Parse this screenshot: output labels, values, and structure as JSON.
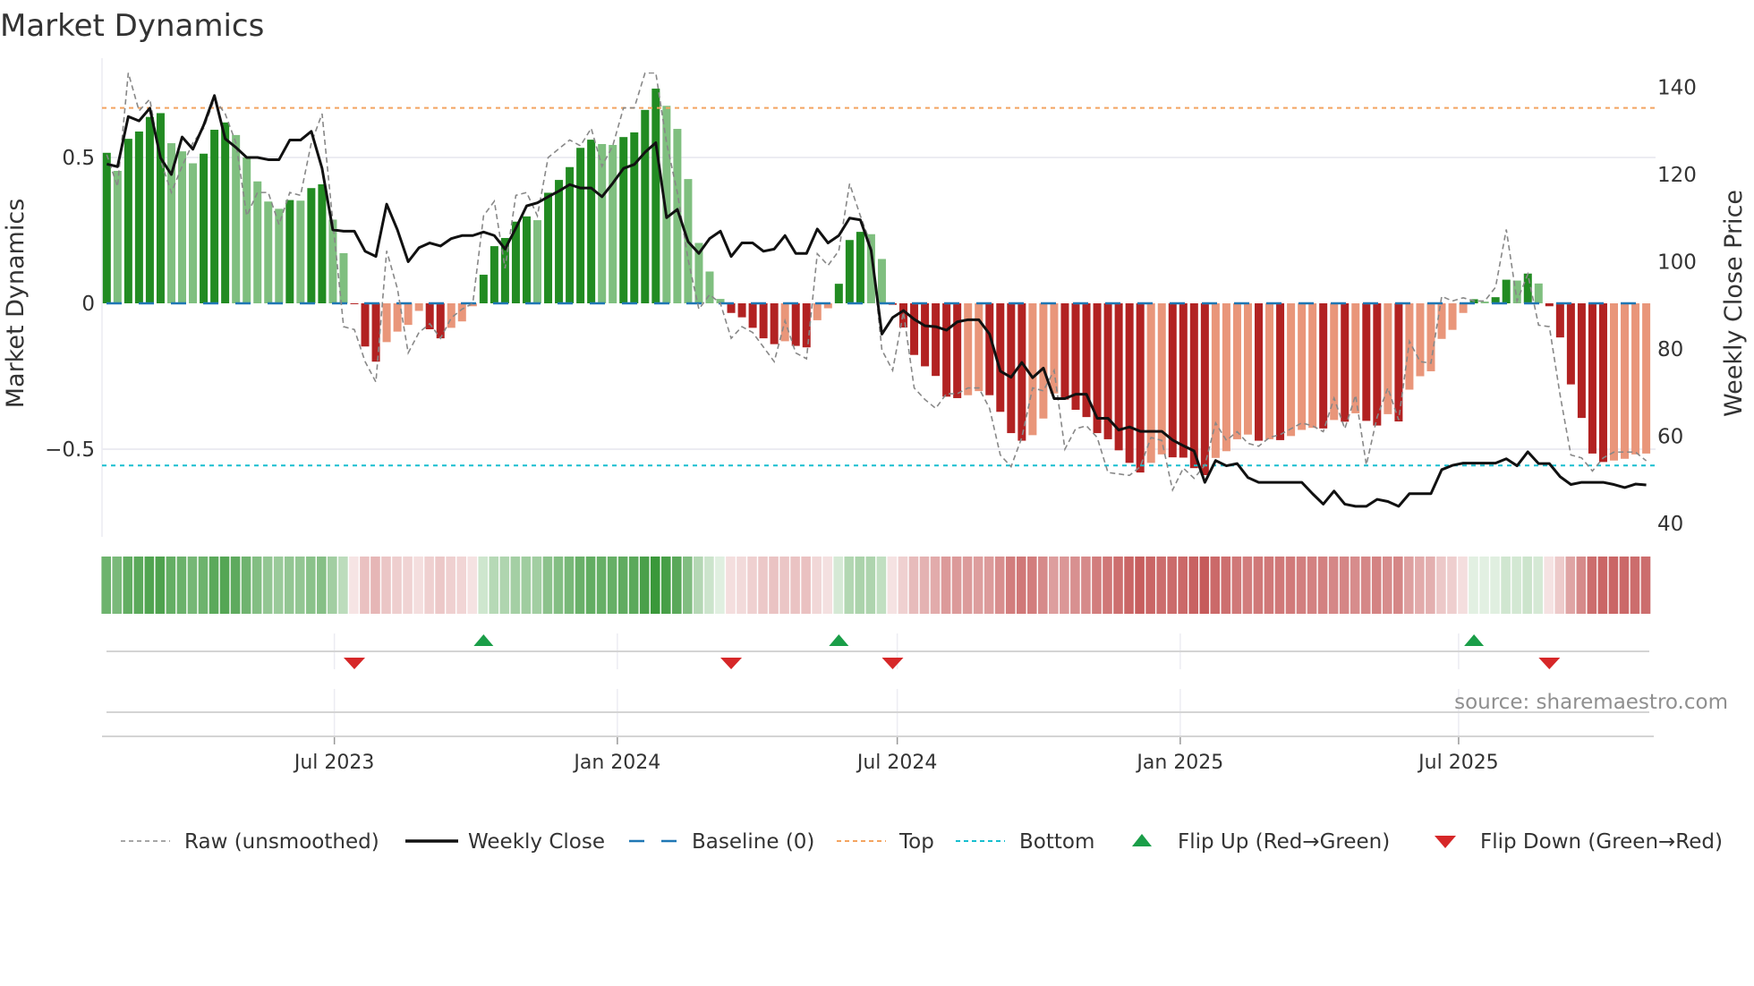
{
  "chart_data": {
    "type": "bar",
    "title": "Market Dynamics",
    "ylabel": "Market Dynamics",
    "y2label": "Weekly Close Price",
    "ylim": [
      -0.8,
      0.79
    ],
    "y2lim": [
      36.9,
      143.4
    ],
    "yticks": [
      {
        "v": 0.5,
        "label": "0.5"
      },
      {
        "v": 0,
        "label": "0"
      },
      {
        "v": -0.5,
        "label": "−0.5"
      }
    ],
    "y2ticks": [
      {
        "v": 140,
        "label": "140"
      },
      {
        "v": 120,
        "label": "120"
      },
      {
        "v": 100,
        "label": "100"
      },
      {
        "v": 80,
        "label": "80"
      },
      {
        "v": 60,
        "label": "60"
      },
      {
        "v": 40,
        "label": "40"
      }
    ],
    "x_start_date": "2023-02-03",
    "x_interval_days": 7,
    "xticks": [
      {
        "date": "2023-07-01",
        "label": "Jul 2023"
      },
      {
        "date": "2024-01-01",
        "label": "Jan 2024"
      },
      {
        "date": "2024-07-01",
        "label": "Jul 2024"
      },
      {
        "date": "2025-01-01",
        "label": "Jan 2025"
      },
      {
        "date": "2025-07-01",
        "label": "Jul 2025"
      }
    ],
    "top_level": 0.67,
    "bottom_level": -0.556,
    "baseline": 0,
    "grid": true,
    "legend_position": "bottom",
    "colors": {
      "pos_strong": "#228b22",
      "pos_weak": "#7fbf7f",
      "neg_strong": "#b22222",
      "neg_weak": "#e9967a",
      "baseline": "#1f77b4",
      "top": "#f4a460",
      "bottom": "#17becf",
      "close": "#111111",
      "raw": "#888888",
      "flip_up": "#1a9e48",
      "flip_down": "#d62728",
      "heat_pos": "34,139,34",
      "heat_neg": "178,34,34"
    },
    "momentum": [
      0.516,
      0.454,
      0.564,
      0.589,
      0.639,
      0.652,
      0.549,
      0.521,
      0.48,
      0.513,
      0.595,
      0.62,
      0.577,
      0.5,
      0.418,
      0.349,
      0.324,
      0.354,
      0.352,
      0.395,
      0.408,
      0.287,
      0.172,
      -0.003,
      -0.148,
      -0.2,
      -0.133,
      -0.097,
      -0.074,
      -0.026,
      -0.089,
      -0.12,
      -0.084,
      -0.062,
      -0.01,
      0.098,
      0.196,
      0.224,
      0.28,
      0.298,
      0.285,
      0.379,
      0.423,
      0.467,
      0.533,
      0.561,
      0.546,
      0.543,
      0.57,
      0.586,
      0.663,
      0.736,
      0.677,
      0.598,
      0.426,
      0.207,
      0.109,
      0.015,
      -0.033,
      -0.048,
      -0.084,
      -0.12,
      -0.14,
      -0.13,
      -0.146,
      -0.151,
      -0.058,
      -0.017,
      0.067,
      0.217,
      0.245,
      0.237,
      0.152,
      -0.005,
      -0.083,
      -0.177,
      -0.216,
      -0.249,
      -0.32,
      -0.325,
      -0.315,
      -0.301,
      -0.315,
      -0.372,
      -0.445,
      -0.471,
      -0.452,
      -0.395,
      -0.309,
      -0.33,
      -0.365,
      -0.39,
      -0.445,
      -0.466,
      -0.504,
      -0.547,
      -0.58,
      -0.547,
      -0.518,
      -0.528,
      -0.529,
      -0.565,
      -0.589,
      -0.53,
      -0.507,
      -0.466,
      -0.45,
      -0.471,
      -0.466,
      -0.469,
      -0.455,
      -0.434,
      -0.427,
      -0.429,
      -0.4,
      -0.406,
      -0.377,
      -0.403,
      -0.419,
      -0.38,
      -0.405,
      -0.296,
      -0.25,
      -0.233,
      -0.122,
      -0.091,
      -0.033,
      0.014,
      0.006,
      0.021,
      0.081,
      0.078,
      0.102,
      0.068,
      -0.01,
      -0.117,
      -0.278,
      -0.393,
      -0.515,
      -0.544,
      -0.539,
      -0.533,
      -0.518,
      -0.515
    ],
    "raw": [
      0.51,
      0.4,
      0.79,
      0.66,
      0.7,
      0.49,
      0.38,
      0.47,
      0.55,
      0.6,
      0.7,
      0.65,
      0.55,
      0.3,
      0.38,
      0.38,
      0.27,
      0.38,
      0.37,
      0.55,
      0.65,
      0.28,
      -0.08,
      -0.09,
      -0.2,
      -0.27,
      0.18,
      0.05,
      -0.17,
      -0.1,
      -0.07,
      -0.12,
      -0.05,
      -0.02,
      0.0,
      0.3,
      0.35,
      0.12,
      0.37,
      0.38,
      0.3,
      0.5,
      0.53,
      0.56,
      0.54,
      0.6,
      0.47,
      0.54,
      0.67,
      0.67,
      0.79,
      0.79,
      0.55,
      0.38,
      0.15,
      -0.02,
      0.03,
      0.0,
      -0.12,
      -0.08,
      -0.1,
      -0.15,
      -0.2,
      -0.06,
      -0.17,
      -0.19,
      0.17,
      0.13,
      0.18,
      0.41,
      0.3,
      0.2,
      -0.16,
      -0.23,
      -0.03,
      -0.29,
      -0.33,
      -0.36,
      -0.31,
      -0.31,
      -0.29,
      -0.29,
      -0.36,
      -0.52,
      -0.56,
      -0.46,
      -0.29,
      -0.3,
      -0.23,
      -0.5,
      -0.43,
      -0.42,
      -0.46,
      -0.58,
      -0.585,
      -0.59,
      -0.56,
      -0.46,
      -0.47,
      -0.64,
      -0.565,
      -0.6,
      -0.555,
      -0.41,
      -0.47,
      -0.44,
      -0.48,
      -0.49,
      -0.46,
      -0.45,
      -0.43,
      -0.41,
      -0.42,
      -0.44,
      -0.325,
      -0.43,
      -0.315,
      -0.554,
      -0.39,
      -0.29,
      -0.4,
      -0.13,
      -0.2,
      -0.205,
      0.024,
      0.008,
      0.019,
      0.008,
      0.008,
      0.055,
      0.253,
      0.008,
      0.1,
      -0.075,
      -0.08,
      -0.315,
      -0.52,
      -0.53,
      -0.575,
      -0.53,
      -0.51,
      -0.51,
      -0.51,
      -0.54
    ],
    "weekly_close": [
      122.4,
      121.8,
      133.3,
      132.3,
      135.2,
      123.8,
      120,
      128.6,
      125.8,
      131.3,
      138.1,
      128.2,
      126.2,
      123.9,
      123.9,
      123.4,
      123.4,
      127.9,
      127.9,
      129.9,
      121.4,
      107.3,
      107,
      107,
      102.4,
      101.2,
      113.2,
      107.3,
      100,
      103.2,
      104.3,
      103.6,
      105.3,
      106,
      106,
      106.8,
      106,
      102.9,
      107.7,
      112.8,
      113.5,
      114.9,
      116.2,
      117.7,
      116.9,
      116.9,
      114.9,
      118,
      121.4,
      122.3,
      125.1,
      127.3,
      110.1,
      112,
      104.6,
      101.9,
      105.3,
      107,
      101.2,
      104.3,
      104.3,
      102.4,
      102.9,
      106,
      101.9,
      101.9,
      107.5,
      104.3,
      106,
      110,
      109.6,
      102.6,
      83.4,
      87.2,
      88.8,
      86.8,
      85.3,
      85.1,
      84.3,
      86.2,
      86.7,
      86.7,
      83.4,
      74.9,
      73.5,
      76.9,
      73.4,
      75.6,
      68.6,
      68.6,
      69.6,
      69.6,
      64.1,
      64.1,
      61.4,
      62.1,
      61.1,
      61.1,
      61.1,
      59.1,
      57.8,
      56.6,
      49.4,
      54.4,
      53.2,
      53.7,
      50.5,
      49.4,
      49.4,
      49.4,
      49.4,
      49.4,
      46.8,
      44.4,
      47.4,
      44.4,
      43.9,
      43.9,
      45.5,
      45,
      43.9,
      46.8,
      46.8,
      46.8,
      52.3,
      53.3,
      53.8,
      53.8,
      53.8,
      53.8,
      54.8,
      53.2,
      56.4,
      53.7,
      53.7,
      50.7,
      48.9,
      49.4,
      49.4,
      49.4,
      48.9,
      48.2,
      49,
      48.8
    ],
    "flip_up_weeks": [
      35,
      68,
      127
    ],
    "flip_down_weeks": [
      23,
      58,
      73,
      134
    ],
    "legend": [
      {
        "key": "raw",
        "label": "Raw (unsmoothed)"
      },
      {
        "key": "close",
        "label": "Weekly Close"
      },
      {
        "key": "baseline",
        "label": "Baseline (0)"
      },
      {
        "key": "top",
        "label": "Top"
      },
      {
        "key": "bottom",
        "label": "Bottom"
      },
      {
        "key": "flip_up",
        "label": "Flip Up (Red→Green)"
      },
      {
        "key": "flip_down",
        "label": "Flip Down (Green→Red)"
      }
    ],
    "watermark": "source: sharemaestro.com"
  }
}
